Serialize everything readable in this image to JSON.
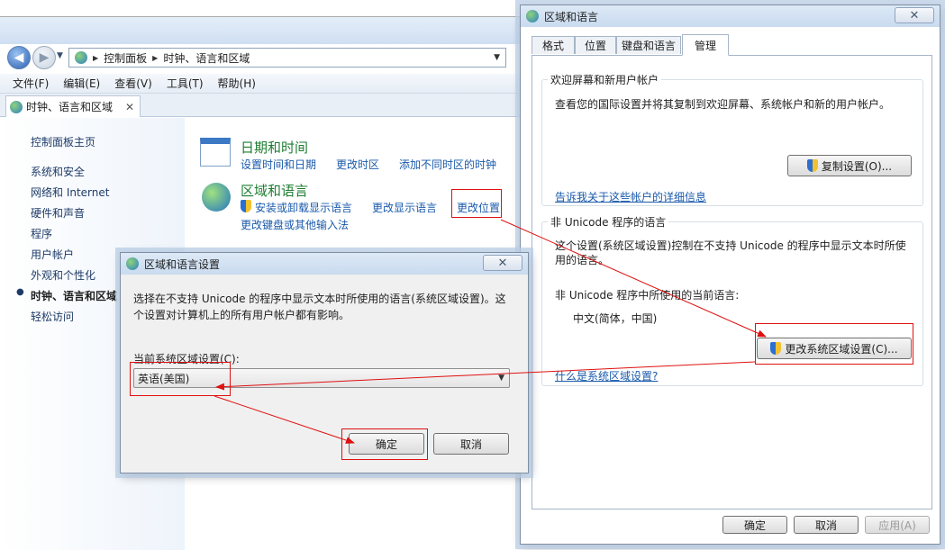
{
  "control_panel": {
    "address": {
      "items": [
        "控制面板",
        "时钟、语言和区域"
      ]
    },
    "menu": [
      "文件(F)",
      "编辑(E)",
      "查看(V)",
      "工具(T)",
      "帮助(H)"
    ],
    "tab_title": "时钟、语言和区域",
    "sidebar": {
      "home": "控制面板主页",
      "items": [
        "系统和安全",
        "网络和 Internet",
        "硬件和声音",
        "程序",
        "用户帐户",
        "外观和个性化",
        "时钟、语言和区域",
        "轻松访问"
      ],
      "selected_index": 6
    },
    "sections": {
      "datetime": {
        "title": "日期和时间",
        "links": [
          "设置时间和日期",
          "更改时区",
          "添加不同时区的时钟"
        ]
      },
      "region": {
        "title": "区域和语言",
        "links": [
          "安装或卸载显示语言",
          "更改显示语言",
          "更改位置",
          "更改键盘或其他输入法"
        ]
      }
    }
  },
  "region_dialog": {
    "title": "区域和语言",
    "tabs": [
      "格式",
      "位置",
      "键盘和语言",
      "管理"
    ],
    "active_tab": "管理",
    "welcome_group": {
      "title": "欢迎屏幕和新用户帐户",
      "description": "查看您的国际设置并将其复制到欢迎屏幕、系统帐户和新的用户帐户。",
      "copy_button": "复制设置(O)...",
      "link": "告诉我关于这些帐户的详细信息"
    },
    "unicode_group": {
      "title": "非 Unicode 程序的语言",
      "description": "这个设置(系统区域设置)控制在不支持 Unicode 的程序中显示文本时所使用的语言。",
      "current_label": "非 Unicode 程序中所使用的当前语言:",
      "current_value": "中文(简体，中国)",
      "change_button": "更改系统区域设置(C)...",
      "link": "什么是系统区域设置?"
    },
    "ok": "确定",
    "cancel": "取消",
    "apply": "应用(A)"
  },
  "locale_dialog": {
    "title": "区域和语言设置",
    "description": "选择在不支持 Unicode 的程序中显示文本时所使用的语言(系统区域设置)。这个设置对计算机上的所有用户帐户都有影响。",
    "current_label": "当前系统区域设置(C):",
    "selected_value": "英语(美国)",
    "ok": "确定",
    "cancel": "取消"
  },
  "colors": {
    "annotation_red": "#e01010",
    "link_blue": "#1a5aab",
    "section_green": "#1e7d32"
  }
}
